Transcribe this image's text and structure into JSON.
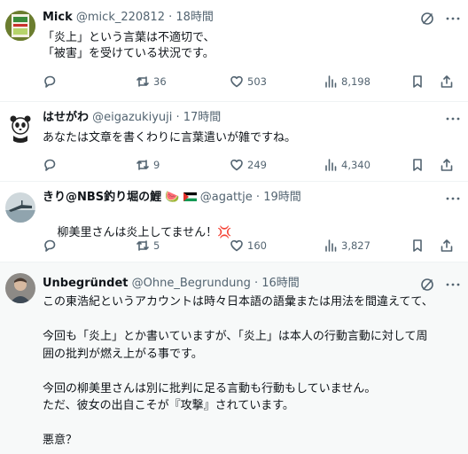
{
  "tweets": [
    {
      "name": "Mick",
      "handle": "@mick_220812",
      "separator": "·",
      "time": "18時間",
      "text": "「炎上」という言葉は不適切で、\n「被害」を受けている状況です。",
      "replies": "",
      "retweets": "36",
      "likes": "503",
      "views": "8,198"
    },
    {
      "name": "はせがわ",
      "handle": "@eigazukiyuji",
      "separator": "·",
      "time": "17時間",
      "text": "あなたは文章を書くわりに言葉遣いが雑ですね。",
      "replies": "",
      "retweets": "9",
      "likes": "249",
      "views": "4,340"
    },
    {
      "name": "きり@NBS釣り堀の鯉",
      "name_emoji": "🍉",
      "handle": "@agattje",
      "separator": "·",
      "time": "19時間",
      "text": "柳美里さんは炎上してません！",
      "text_emoji": "💢",
      "replies": "",
      "retweets": "5",
      "likes": "160",
      "views": "3,827"
    },
    {
      "name": "Unbegründet",
      "handle": "@Ohne_Begrundung",
      "separator": "·",
      "time": "16時間",
      "text": "この東浩紀というアカウントは時々日本語の語彙または用法を間違えてて、\n\n今回も「炎上」とか書いていますが、「炎上」は本人の行動言動に対して周\n囲の批判が燃え上がる事です。\n\n今回の柳美里さんは別に批判に足る言動も行動もしていません。\nただ、彼女の出自こそが『攻撃』されています。\n\n悪意？"
    }
  ],
  "colors": {
    "text": "#0f1419",
    "secondary": "#536471",
    "divider": "#eff3f4",
    "highlight_bg": "#f7f9f9"
  },
  "icons": [
    "grok-icon",
    "more-icon",
    "reply-icon",
    "retweet-icon",
    "like-icon",
    "views-icon",
    "bookmark-icon",
    "share-icon"
  ]
}
